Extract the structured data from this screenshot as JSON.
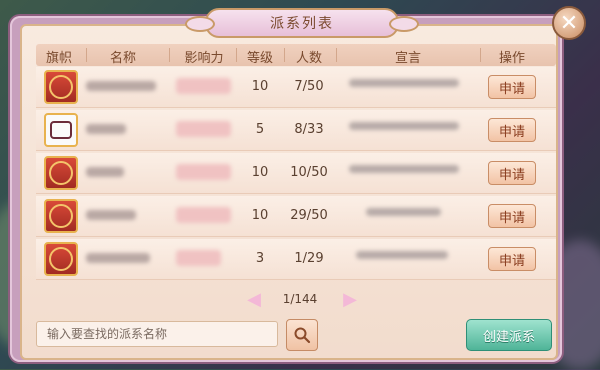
{
  "window": {
    "title": "派系列表"
  },
  "table": {
    "headers": [
      "旗帜",
      "名称",
      "影响力",
      "等级",
      "人数",
      "宣言",
      "操作"
    ],
    "rows": [
      {
        "level": "10",
        "members": "7/50",
        "badge_style": "red",
        "action": "申请"
      },
      {
        "level": "5",
        "members": "8/33",
        "badge_style": "white",
        "action": "申请"
      },
      {
        "level": "10",
        "members": "10/50",
        "badge_style": "red",
        "action": "申请"
      },
      {
        "level": "10",
        "members": "29/50",
        "badge_style": "red",
        "action": "申请"
      },
      {
        "level": "3",
        "members": "1/29",
        "badge_style": "red",
        "action": "申请"
      }
    ]
  },
  "pager": {
    "text": "1/144",
    "prev_icon": "chevron-left-icon",
    "next_icon": "chevron-right-icon"
  },
  "search": {
    "placeholder": "输入要查找的派系名称",
    "icon": "search-icon"
  },
  "create_button": {
    "label": "创建派系"
  },
  "close_button": {
    "icon": "close-icon",
    "glyph": "✕"
  },
  "colors": {
    "accent_pink": "#c79fbd",
    "button_green": "#4fb498",
    "text_brown": "#7a4a2e"
  }
}
